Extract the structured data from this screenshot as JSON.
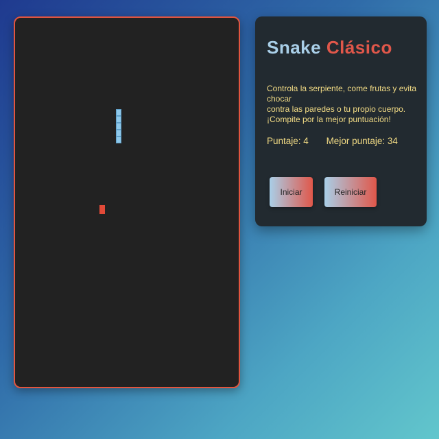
{
  "game": {
    "title_part1": "Snake",
    "title_part2": "Clásico",
    "description_lines": [
      "Controla la serpiente, come frutas y evita chocar",
      "contra las paredes o tu propio cuerpo.",
      "¡Compite por la mejor puntuación!"
    ],
    "score_label": "Puntaje: 4",
    "best_score_label": "Mejor puntaje: 34",
    "score": 4,
    "best_score": 34
  },
  "buttons": {
    "start_label": "Iniciar",
    "reset_label": "Reiniciar"
  },
  "colors": {
    "board_background": "#222222",
    "board_border": "#e2553f",
    "snake": "#8ec8ea",
    "fruit": "#e24a38",
    "text_accent": "#f3dc85",
    "title_blue": "#a9cfe8",
    "title_red": "#e0574a"
  },
  "board": {
    "grid_columns": 40,
    "grid_rows": 53,
    "snake_cells": [
      [
        18,
        13
      ],
      [
        18,
        14
      ],
      [
        18,
        15
      ],
      [
        18,
        16
      ],
      [
        18,
        17
      ]
    ],
    "fruit_cell": [
      15,
      27
    ]
  }
}
